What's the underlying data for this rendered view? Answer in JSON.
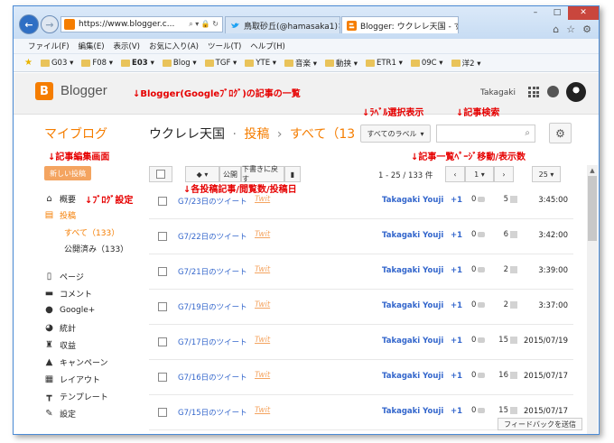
{
  "browser": {
    "url": "https://www.blogger.c...",
    "tabs": [
      {
        "label": "鳥取砂丘(@hamasaka1)さん ..."
      },
      {
        "label": "Blogger: ウクレレ天国 - す..."
      }
    ],
    "window_controls": {
      "minimize": "–",
      "maximize": "□",
      "close": "✕"
    },
    "menu": [
      "ファイル(F)",
      "編集(E)",
      "表示(V)",
      "お気に入り(A)",
      "ツール(T)",
      "ヘルプ(H)"
    ],
    "favorites": [
      "G03 ▾",
      "F08 ▾",
      "E03 ▾",
      "Blog ▾",
      "TGF ▾",
      "YTE ▾",
      "音楽 ▾",
      "動挟 ▾",
      "ETR1 ▾",
      "09C ▾",
      "洋2 ▾"
    ]
  },
  "header": {
    "logo_letter": "B",
    "app_name": "Blogger",
    "username": "Takagaki"
  },
  "annotations": {
    "list": "↓Blogger(Googleﾌﾞﾛｸﾞ)の記事の一覧",
    "label_select": "↓ﾗﾍﾞﾙ選択表示",
    "search": "↓記事検索",
    "edit_screen": "↓記事編集画面",
    "paging": "↓記事一覧ﾍﾟｰｼﾞ移動/表示数",
    "blog_settings": "↓ﾌﾞﾛｸﾞ設定",
    "post_info": "↓各投稿記事/閲覧数/投稿日"
  },
  "subheader": {
    "my_blog": "マイブログ",
    "blog_title": "ウクレレ天国",
    "dot": "·",
    "posts": "投稿",
    "arrow": "›",
    "all": "すべて（13",
    "label_dropdown": "すべてのラベル"
  },
  "sidebar": {
    "new_post": "新しい投稿",
    "items": [
      {
        "icon": "home-icon",
        "label": "概要"
      },
      {
        "icon": "document-icon",
        "label": "投稿"
      },
      {
        "icon": "page-icon",
        "label": "ページ"
      },
      {
        "icon": "comment-icon",
        "label": "コメント"
      },
      {
        "icon": "google-plus-icon",
        "label": "Google+"
      },
      {
        "icon": "pie-chart-icon",
        "label": "統計"
      },
      {
        "icon": "trophy-icon",
        "label": "収益"
      },
      {
        "icon": "campaign-icon",
        "label": "キャンペーン"
      },
      {
        "icon": "layout-icon",
        "label": "レイアウト"
      },
      {
        "icon": "template-icon",
        "label": "テンプレート"
      },
      {
        "icon": "wrench-icon",
        "label": "設定"
      }
    ],
    "sub_all": "すべて（133）",
    "sub_published": "公開済み（133）"
  },
  "toolbar": {
    "publish": "公開",
    "revert_draft": "下書きに戻す",
    "range": "1 - 25 / 133 件",
    "page": "1",
    "page_size": "25"
  },
  "posts": [
    {
      "title": "G7/23日のツイート",
      "label": "Twit",
      "author": "Takagaki Youji",
      "plus": "+1",
      "comments": "0",
      "views": "5",
      "date": "3:45:00"
    },
    {
      "title": "G7/22日のツイート",
      "label": "Twit",
      "author": "Takagaki Youji",
      "plus": "+1",
      "comments": "0",
      "views": "6",
      "date": "3:42:00"
    },
    {
      "title": "G7/21日のツイート",
      "label": "Twit",
      "author": "Takagaki Youji",
      "plus": "+1",
      "comments": "0",
      "views": "2",
      "date": "3:39:00"
    },
    {
      "title": "G7/19日のツイート",
      "label": "Twit",
      "author": "Takagaki Youji",
      "plus": "+1",
      "comments": "0",
      "views": "2",
      "date": "3:37:00"
    },
    {
      "title": "G7/17日のツイート",
      "label": "Twit",
      "author": "Takagaki Youji",
      "plus": "+1",
      "comments": "0",
      "views": "15",
      "date": "2015/07/19"
    },
    {
      "title": "G7/16日のツイート",
      "label": "Twit",
      "author": "Takagaki Youji",
      "plus": "+1",
      "comments": "0",
      "views": "16",
      "date": "2015/07/17"
    },
    {
      "title": "G7/15日のツイート",
      "label": "Twit",
      "author": "Takagaki Youji",
      "plus": "+1",
      "comments": "0",
      "views": "15",
      "date": "2015/07/17"
    }
  ],
  "feedback": "フィードバックを送信",
  "colors": {
    "accent": "#f57d00",
    "link": "#3366cc",
    "annotation": "#e60000"
  }
}
